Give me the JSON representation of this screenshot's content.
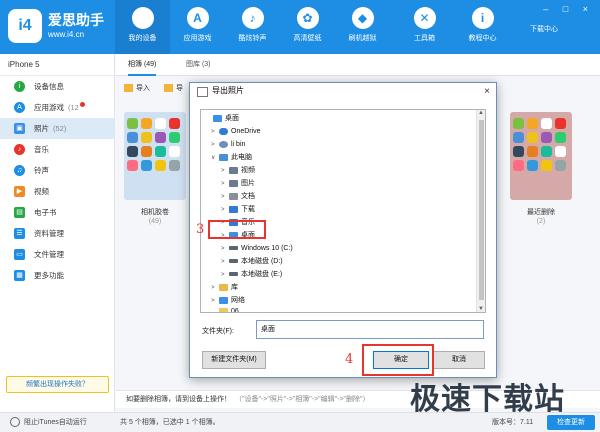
{
  "app": {
    "brand": "爱思助手",
    "url": "www.i4.cn",
    "logo_text": "i4",
    "download_center": "下载中心",
    "window_controls": "– □ ×"
  },
  "nav": [
    {
      "label": "我的设备",
      "icon": "apple-icon",
      "glyph": "",
      "active": true
    },
    {
      "label": "应用游戏",
      "icon": "app-store-icon",
      "glyph": "A"
    },
    {
      "label": "酷炫铃声",
      "icon": "bell-icon",
      "glyph": "♪"
    },
    {
      "label": "高清壁纸",
      "icon": "wallpaper-icon",
      "glyph": "✿"
    },
    {
      "label": "刷机越狱",
      "icon": "dropbox-icon",
      "glyph": "◆"
    },
    {
      "label": "工具箱",
      "icon": "tools-icon",
      "glyph": "✕"
    },
    {
      "label": "教程中心",
      "icon": "info-icon",
      "glyph": "i"
    }
  ],
  "sidebar": {
    "device": "iPhone 5",
    "items": [
      {
        "label": "设备信息",
        "icon": "info-circle-icon",
        "color": "#28a745"
      },
      {
        "label": "应用游戏",
        "count": "(12",
        "dot": true,
        "icon": "app-icon",
        "color": "#1d8ee4"
      },
      {
        "label": "照片",
        "count": "(52)",
        "active": true,
        "icon": "photo-icon",
        "color": "#3b8fe8"
      },
      {
        "label": "音乐",
        "icon": "music-icon",
        "color": "#e8342c"
      },
      {
        "label": "铃声",
        "icon": "bell-icon",
        "color": "#1d8ee4"
      },
      {
        "label": "视频",
        "icon": "video-icon",
        "color": "#f08a24"
      },
      {
        "label": "电子书",
        "icon": "book-icon",
        "color": "#28a745"
      },
      {
        "label": "资料管理",
        "icon": "contacts-icon",
        "color": "#1d8ee4"
      },
      {
        "label": "文件管理",
        "icon": "folder-icon",
        "color": "#1d8ee4"
      },
      {
        "label": "更多功能",
        "icon": "grid-icon",
        "color": "#1d8ee4"
      }
    ],
    "help_label": "频繁出现操作失败？"
  },
  "tabs": [
    "相簿 (49)",
    "图库 (3)"
  ],
  "toolbar": {
    "import": "导入",
    "export_partial": "导"
  },
  "albums": [
    {
      "name": "相机胶卷",
      "count": "(49)"
    },
    {
      "name": "最近删除",
      "count": "(2)"
    }
  ],
  "hint": {
    "text": "如要删除相簿，请到设备上操作！",
    "path": "（\"设备\"->\"照片\"->\"相簿\"->\"编辑\"->\"删除\"）"
  },
  "status": {
    "itunes": "阻止iTunes自动运行",
    "summary": "共 5 个相簿，已选中 1 个相簿。",
    "version": "版本号：7.11",
    "update": "检查更新"
  },
  "watermark": "极速下载站",
  "dialog": {
    "title": "导出照片",
    "close": "×",
    "tree": [
      {
        "label": "桌面",
        "toggle": "",
        "icon": "desktop-icon",
        "color": "#3b8fe8"
      },
      {
        "label": "OneDrive",
        "toggle": ">",
        "icon": "cloud-icon",
        "color": "#2f7bd6"
      },
      {
        "label": "li bin",
        "toggle": ">",
        "icon": "user-icon",
        "color": "#6b8fb8"
      },
      {
        "label": "此电脑",
        "toggle": "∨",
        "icon": "computer-icon",
        "color": "#4a90d9"
      },
      {
        "label": "视频",
        "toggle": ">",
        "icon": "video-folder-icon",
        "color": "#6a7c8f"
      },
      {
        "label": "图片",
        "toggle": ">",
        "icon": "pictures-folder-icon",
        "color": "#6a7c8f"
      },
      {
        "label": "文档",
        "toggle": ">",
        "icon": "documents-folder-icon",
        "color": "#8a8f98"
      },
      {
        "label": "下载",
        "toggle": ">",
        "icon": "download-folder-icon",
        "color": "#2f7bd6"
      },
      {
        "label": "音乐",
        "toggle": ">",
        "icon": "music-folder-icon",
        "color": "#2f7bd6"
      },
      {
        "label": "桌面",
        "toggle": ">",
        "icon": "desktop-icon",
        "color": "#3b8fe8",
        "selected": true
      },
      {
        "label": "Windows 10 (C:)",
        "toggle": ">",
        "icon": "drive-icon",
        "color": "#5a6570"
      },
      {
        "label": "本地磁盘 (D:)",
        "toggle": ">",
        "icon": "drive-icon",
        "color": "#5a6570"
      },
      {
        "label": "本地磁盘 (E:)",
        "toggle": ">",
        "icon": "drive-icon",
        "color": "#5a6570"
      },
      {
        "label": "库",
        "toggle": ">",
        "icon": "library-icon",
        "color": "#e9b949"
      },
      {
        "label": "网络",
        "toggle": ">",
        "icon": "network-icon",
        "color": "#3b8fe8"
      },
      {
        "label": "06",
        "toggle": "",
        "icon": "folder-icon",
        "color": "#f1c65a"
      }
    ],
    "folder_label": "文件夹(F):",
    "folder_value": "桌面",
    "new_folder": "新建文件夹(M)",
    "ok": "确定",
    "cancel": "取消"
  },
  "annotations": {
    "step3": "3",
    "step4": "4"
  }
}
